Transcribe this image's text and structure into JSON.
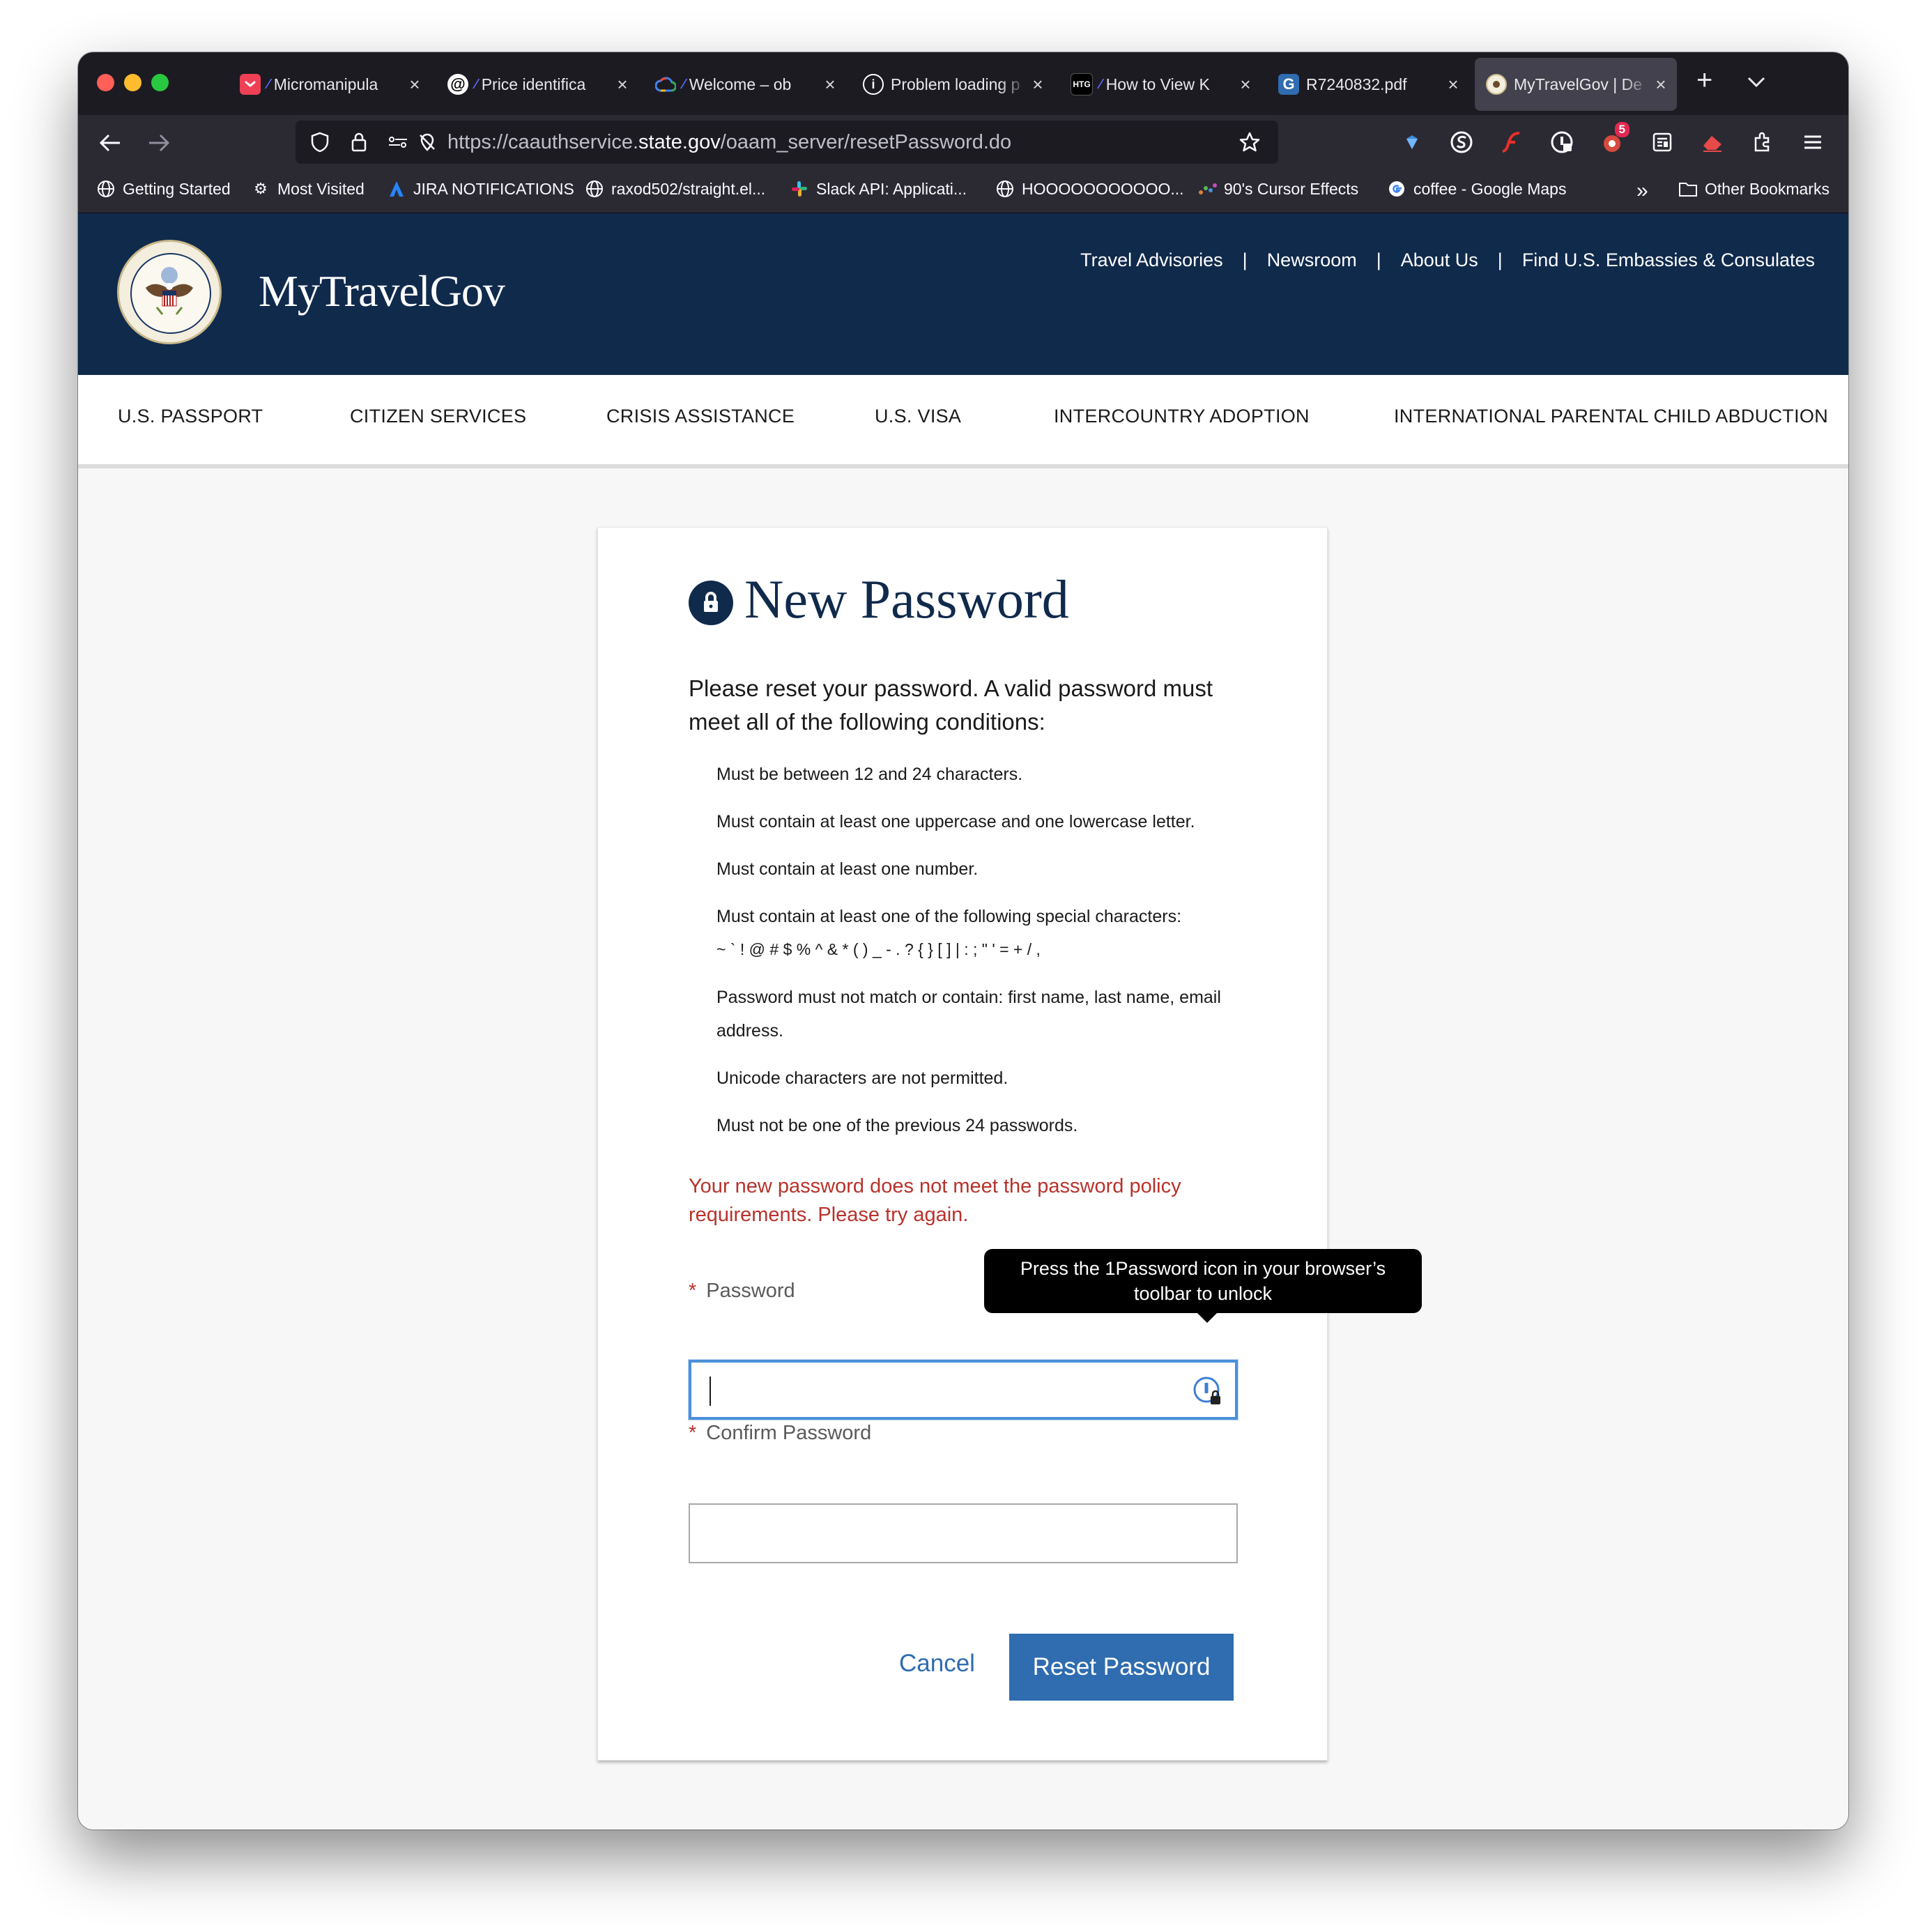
{
  "browser": {
    "tabs": [
      {
        "label": "Micromanipula",
        "icon": "pocket-icon",
        "color": "#ef4056",
        "loading": true
      },
      {
        "label": "Price identifica",
        "icon": "threads-icon",
        "color": "#000000",
        "loading": true
      },
      {
        "label": "Welcome – ob",
        "icon": "google-cloud-icon",
        "color": "#4285f4",
        "loading": true
      },
      {
        "label": "Problem loading p",
        "icon": "info-icon",
        "color": "#ffffff",
        "loading": false
      },
      {
        "label": "How to View K",
        "icon": "htg-icon",
        "color": "#000000",
        "loading": true,
        "fav_text": "HTG"
      },
      {
        "label": "R7240832.pdf",
        "icon": "pdf-g-icon",
        "color": "#2f6cb0",
        "loading": false,
        "fav_text": "G"
      },
      {
        "label": "MyTravelGov | De",
        "icon": "state-seal-icon",
        "color": "#c9b98a",
        "loading": false,
        "active": true
      }
    ],
    "tab_close": "×",
    "url_prefix": "https://caauthservice.",
    "url_domain": "state.gov",
    "url_path": "/oaam_server/resetPassword.do",
    "ext_badge": "5",
    "bookmarks": [
      {
        "label": "Getting Started",
        "icon": "globe-icon"
      },
      {
        "label": "Most Visited",
        "icon": "gear-icon"
      },
      {
        "label": "JIRA NOTIFICATIONS",
        "icon": "jira-icon"
      },
      {
        "label": "raxod502/straight.el...",
        "icon": "globe-icon"
      },
      {
        "label": "Slack API: Applicati...",
        "icon": "slack-icon"
      },
      {
        "label": "HOOOOOOOOOOO...",
        "icon": "globe-icon"
      },
      {
        "label": "90's Cursor Effects",
        "icon": "cursor-effects-icon"
      },
      {
        "label": "coffee - Google Maps",
        "icon": "google-icon"
      }
    ],
    "other_bookmarks": "Other Bookmarks"
  },
  "site": {
    "brand": "MyTravelGov",
    "top_links": [
      "Travel Advisories",
      "Newsroom",
      "About Us",
      "Find U.S. Embassies & Consulates"
    ],
    "separator": "|",
    "main_nav": [
      "U.S. PASSPORT",
      "CITIZEN SERVICES",
      "CRISIS ASSISTANCE",
      "U.S. VISA",
      "INTERCOUNTRY ADOPTION",
      "INTERNATIONAL PARENTAL CHILD ABDUCTION"
    ]
  },
  "form": {
    "title": "New Password",
    "intro": "Please reset your password. A valid password must meet all of the following conditions:",
    "rules": [
      "Must be between 12 and 24 characters.",
      "Must contain at least one uppercase and one lowercase letter.",
      "Must contain at least one number.",
      "Must contain at least one of the following special characters:",
      "~ ` ! @ # $ % ^ & * ( ) _ - . ? { } [ ] | : ; \" ' = + / ,",
      "Password must not match or contain: first name, last name, email",
      "address.",
      "Unicode characters are not permitted.",
      "Must not be one of the previous 24 passwords."
    ],
    "error": "Your new password does not meet the password policy requirements. Please try again.",
    "required_mark": "*",
    "password_label": "Password",
    "password_value": "",
    "confirm_label": "Confirm Password",
    "confirm_value": "",
    "cancel": "Cancel",
    "submit": "Reset Password"
  },
  "tooltip": {
    "line1": "Press the 1Password icon in your browser’s",
    "line2": "toolbar to unlock"
  },
  "colors": {
    "header_bg": "#102a4c",
    "accent": "#2f6cb0",
    "error": "#b8322b"
  }
}
